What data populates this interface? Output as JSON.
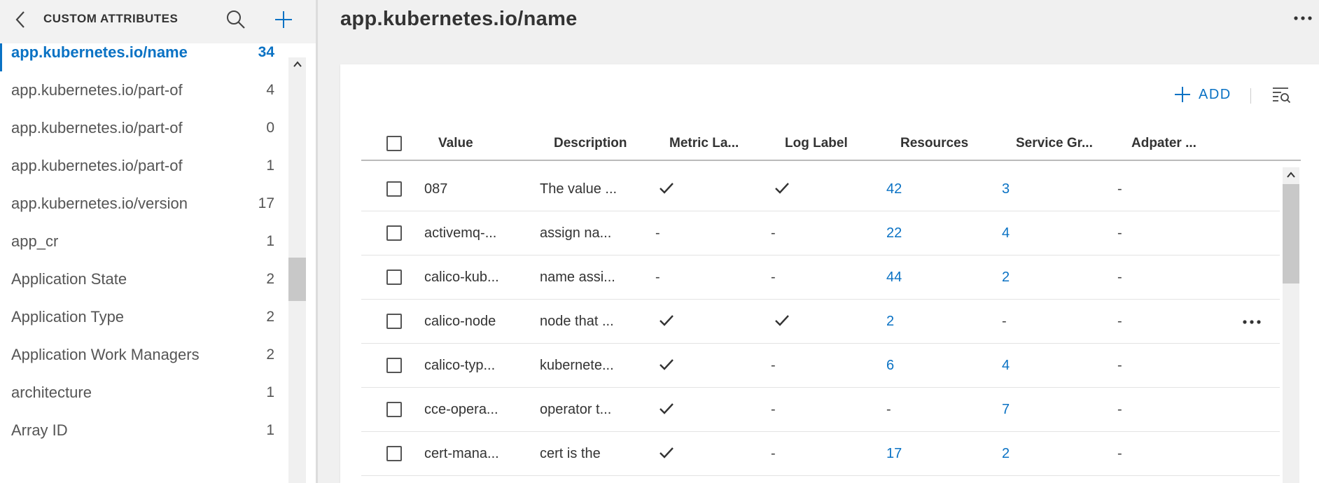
{
  "sidebar": {
    "title": "CUSTOM ATTRIBUTES",
    "items": [
      {
        "label": "app.kubernetes.io/name",
        "count": "34",
        "active": true
      },
      {
        "label": "app.kubernetes.io/part-of",
        "count": "4"
      },
      {
        "label": "app.kubernetes.io/part-of",
        "count": "0"
      },
      {
        "label": "app.kubernetes.io/part-of",
        "count": "1"
      },
      {
        "label": "app.kubernetes.io/version",
        "count": "17"
      },
      {
        "label": "app_cr",
        "count": "1"
      },
      {
        "label": "Application State",
        "count": "2"
      },
      {
        "label": "Application Type",
        "count": "2"
      },
      {
        "label": "Application Work Managers",
        "count": "2"
      },
      {
        "label": "architecture",
        "count": "1"
      },
      {
        "label": "Array ID",
        "count": "1"
      }
    ]
  },
  "main": {
    "title": "app.kubernetes.io/name",
    "toolbar": {
      "add_label": "ADD"
    },
    "columns": [
      "Value",
      "Description",
      "Metric La...",
      "Log Label",
      "Resources",
      "Service Gr...",
      "Adpater ..."
    ],
    "rows": [
      {
        "value": "087",
        "description": "The value ...",
        "metric": true,
        "log": true,
        "resources": "42",
        "service": "3",
        "adapter": "-"
      },
      {
        "value": "activemq-...",
        "description": "assign na...",
        "metric": "-",
        "log": "-",
        "resources": "22",
        "service": "4",
        "adapter": "-"
      },
      {
        "value": "calico-kub...",
        "description": "name assi...",
        "metric": "-",
        "log": "-",
        "resources": "44",
        "service": "2",
        "adapter": "-"
      },
      {
        "value": "calico-node",
        "description": "node that ...",
        "metric": true,
        "log": true,
        "resources": "2",
        "service": "-",
        "adapter": "-",
        "more": true
      },
      {
        "value": "calico-typ...",
        "description": "kubernete...",
        "metric": true,
        "log": "-",
        "resources": "6",
        "service": "4",
        "adapter": "-"
      },
      {
        "value": "cce-opera...",
        "description": "operator t...",
        "metric": true,
        "log": "-",
        "resources": "-",
        "service": "7",
        "adapter": "-"
      },
      {
        "value": "cert-mana...",
        "description": "cert is the",
        "metric": true,
        "log": "-",
        "resources": "17",
        "service": "2",
        "adapter": "-"
      }
    ]
  },
  "colors": {
    "accent": "#0a72c4",
    "text": "#333333",
    "header_bg": "#f2f2f2"
  }
}
